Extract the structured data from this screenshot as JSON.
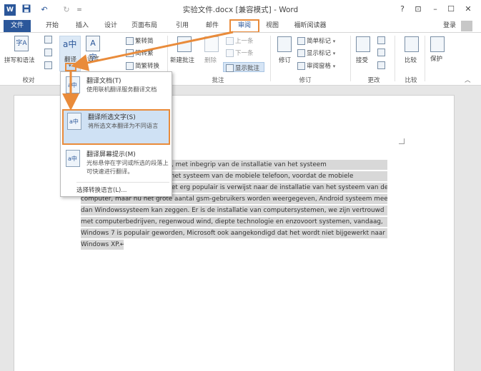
{
  "titlebar": {
    "word_icon": "W",
    "save_icon": "save-icon",
    "undo_icon": "↶",
    "redo_icon": "↻",
    "customize_icon": "=",
    "document_title": "实验文件.docx [兼容模式] - Word",
    "help": "?",
    "ribbon_display": "⊡",
    "minimize": "–",
    "maximize": "☐",
    "close": "✕"
  },
  "tabs": {
    "file": "文件",
    "home": "开始",
    "insert": "插入",
    "design": "设计",
    "layout": "页面布局",
    "references": "引用",
    "mailings": "邮件",
    "review": "审阅",
    "view": "视图",
    "foxit": "福昕阅读器",
    "login": "登录"
  },
  "ribbon": {
    "proofing": {
      "spelling": "拼写和语法",
      "label": "校对"
    },
    "translate_label": "翻译",
    "language_label": "语言",
    "chinese": {
      "trad": "繁转简",
      "simp": "简转繁",
      "convert": "简繁转换"
    },
    "comments": {
      "new": "新建批注",
      "delete": "删除",
      "prev": "上一条",
      "next": "下一条",
      "show": "显示批注",
      "label": "批注"
    },
    "tracking": {
      "track": "修订",
      "markup": "简单标记",
      "show_markup": "显示标记",
      "reviewing_pane": "审阅窗格",
      "label": "修订"
    },
    "changes": {
      "accept": "接受",
      "label": "更改"
    },
    "compare": {
      "compare": "比较",
      "label": "比较"
    },
    "protect": {
      "protect": "保护"
    }
  },
  "menu": {
    "translate_doc": {
      "title": "翻译文档(T)",
      "desc": "使用联机翻译服务翻译文档"
    },
    "translate_selection": {
      "title": "翻译所选文字(S)",
      "desc": "将所选文本翻译为不同语言"
    },
    "mini_translator": {
      "title": "翻译屏幕提示(M)",
      "desc": "光标悬停在字词或所选的段落上可快速进行翻译。"
    },
    "choose_language": "选择转换语言(L)..."
  },
  "document": {
    "lines": [
      "stem) in brede zin, met inbegrip van de installatie van het systeem",
      "latie van het systeem van de mobiele telefoon, voordat de mobiele",
      "et erg populair is verwijst naar de installatie van het systeem van de",
      "computer, maar nu het grote aantal gsm-gebruikers worden weergegeven, Android systeem meer",
      "dan Windowssysteem kan zeggen. Er is de installatie van computersystemen, we zijn vertrouwd",
      "met computerbedrijven, regenwoud wind, diepte technologie en enzovoort systemen, vandaag,",
      "Windows 7 is populair geworden, Microsoft ook aangekondigd dat het wordt niet bijgewerkt naar",
      "Windows XP.↵"
    ]
  },
  "colors": {
    "word_blue": "#2b579a",
    "highlight_orange": "#e98b3a",
    "selection_gray": "#d8d8d8",
    "menu_hover": "#cfe1f4"
  }
}
